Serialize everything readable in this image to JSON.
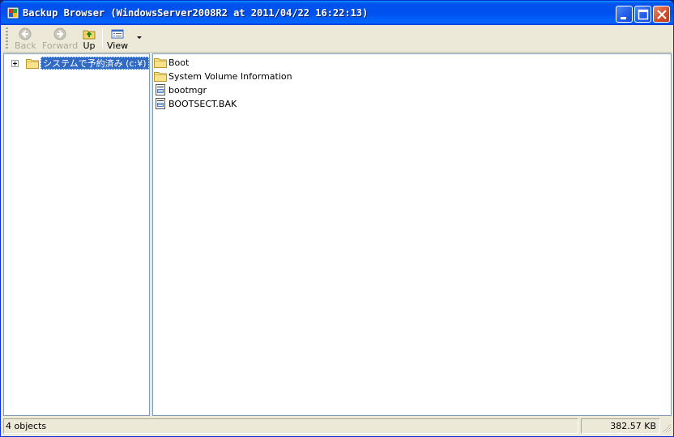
{
  "window": {
    "title": "Backup Browser (WindowsServer2008R2 at 2011/04/22 16:22:13)"
  },
  "toolbar": {
    "back_label": "Back",
    "forward_label": "Forward",
    "up_label": "Up",
    "view_label": "View"
  },
  "tree": {
    "root_label": "システムで予約済み (c:¥)"
  },
  "files": [
    {
      "name": "Boot",
      "type": "folder"
    },
    {
      "name": "System Volume Information",
      "type": "folder"
    },
    {
      "name": "bootmgr",
      "type": "file"
    },
    {
      "name": "BOOTSECT.BAK",
      "type": "file"
    }
  ],
  "status": {
    "objects": "4 objects",
    "size": "382.57  KB"
  },
  "colors": {
    "titlebar": "#0054e3",
    "selection": "#316ac5",
    "window_bg": "#ece9d8",
    "close_button": "#d4502c"
  }
}
